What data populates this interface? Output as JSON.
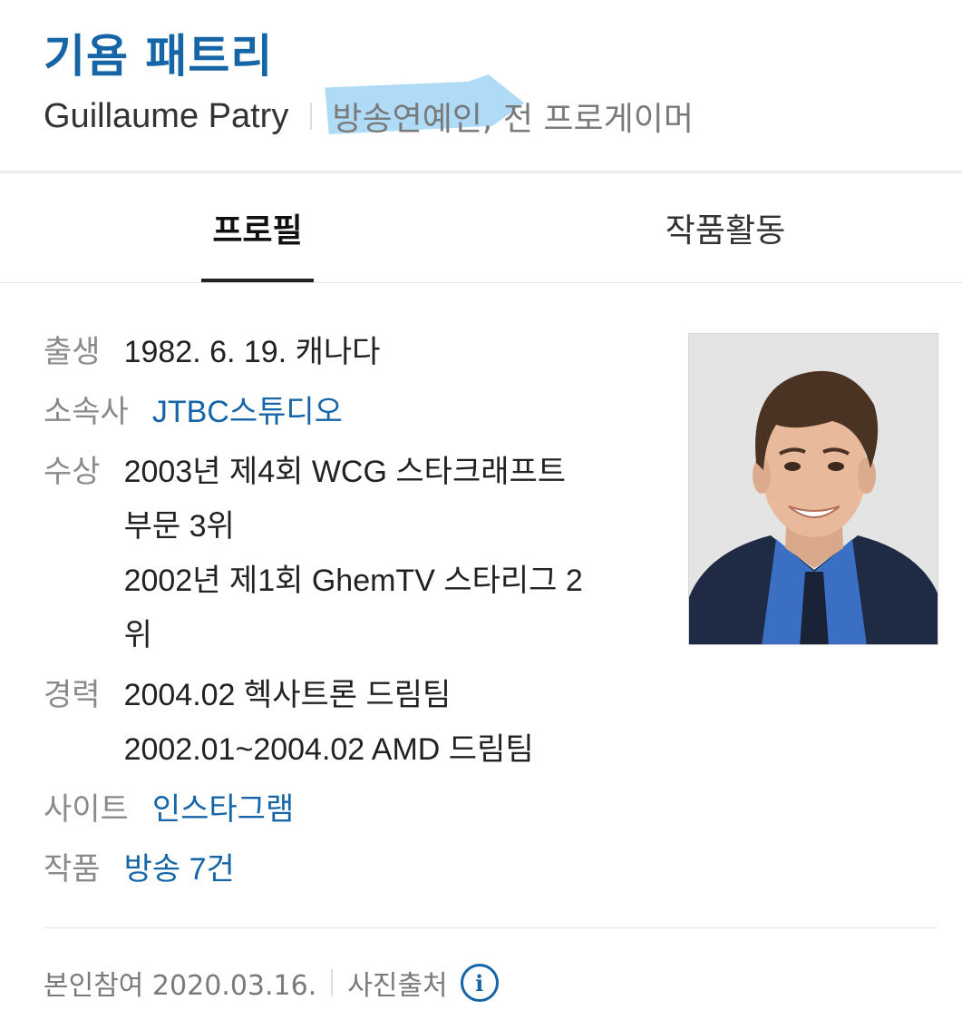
{
  "header": {
    "name": "기욤 패트리",
    "english_name": "Guillaume Patry",
    "occupation_highlighted": "방송연예인,",
    "occupation_rest": " 전 프로게이머"
  },
  "tabs": [
    {
      "label": "프로필",
      "active": true
    },
    {
      "label": "작품활동",
      "active": false
    }
  ],
  "profile": {
    "birth": {
      "label": "출생",
      "value": "1982. 6. 19. 캐나다"
    },
    "agency": {
      "label": "소속사",
      "value": "JTBC스튜디오"
    },
    "awards": {
      "label": "수상",
      "lines": [
        "2003년 제4회 WCG 스타크래프트",
        "부문 3위",
        "2002년 제1회 GhemTV 스타리그 2",
        "위"
      ]
    },
    "career": {
      "label": "경력",
      "lines": [
        "2004.02 헥사트론 드림팀",
        "2002.01~2004.02 AMD 드림팀"
      ]
    },
    "site": {
      "label": "사이트",
      "value": "인스타그램"
    },
    "works": {
      "label": "작품",
      "value": "방송 7건"
    }
  },
  "footer": {
    "participation": "본인참여 2020.03.16.",
    "photo_source": "사진출처",
    "info_icon": "i"
  },
  "colors": {
    "accent": "#1565a7",
    "highlight": "#6ebef0"
  }
}
